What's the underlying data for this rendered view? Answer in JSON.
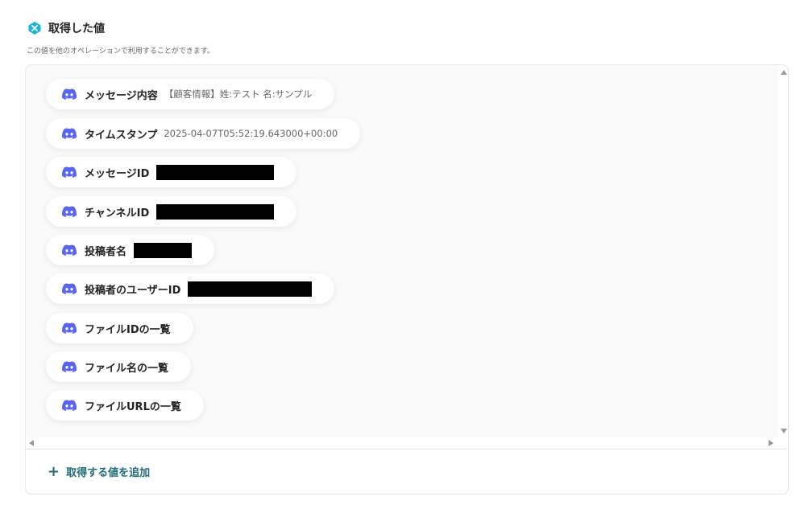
{
  "header": {
    "title": "取得した値",
    "subtitle": "この値を他のオペレーションで利用することができます。",
    "icon": "yoom-x-icon",
    "accent": "#1ab4d6"
  },
  "items": [
    {
      "label": "メッセージ内容",
      "value": "【顧客情報】姓:テスト 名:サンプル",
      "redacted": false
    },
    {
      "label": "タイムスタンプ",
      "value": "2025-04-07T05:52:19.643000+00:00",
      "redacted": false
    },
    {
      "label": "メッセージID",
      "value": "",
      "redacted": true
    },
    {
      "label": "チャンネルID",
      "value": "",
      "redacted": true
    },
    {
      "label": "投稿者名",
      "value": "",
      "redacted": true
    },
    {
      "label": "投稿者のユーザーID",
      "value": "",
      "redacted": true
    },
    {
      "label": "ファイルIDの一覧",
      "value": "",
      "redacted": false
    },
    {
      "label": "ファイル名の一覧",
      "value": "",
      "redacted": false
    },
    {
      "label": "ファイルURLの一覧",
      "value": "",
      "redacted": false
    }
  ],
  "item_icon": "discord-icon",
  "discord_color": "#5865f2",
  "add_button": {
    "label": "取得する値を追加",
    "icon": "plus-icon",
    "color": "#1f6b7a"
  }
}
